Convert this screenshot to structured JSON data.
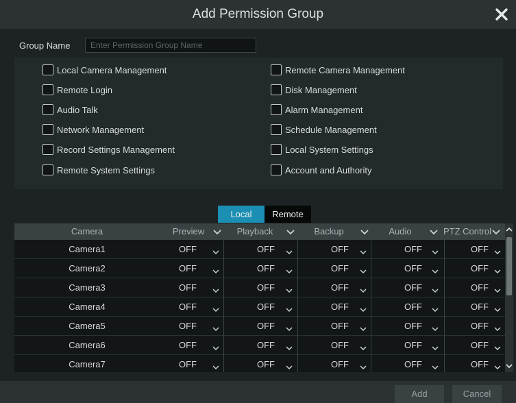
{
  "dialog": {
    "title": "Add Permission Group",
    "close_icon": "close-icon"
  },
  "group": {
    "label": "Group Name",
    "value": "",
    "placeholder": "Enter Permission Group Name"
  },
  "permissions": {
    "left": [
      {
        "label": "Local Camera Management",
        "checked": false
      },
      {
        "label": "Remote Login",
        "checked": false
      },
      {
        "label": "Audio Talk",
        "checked": false
      },
      {
        "label": "Network Management",
        "checked": false
      },
      {
        "label": "Record Settings Management",
        "checked": false
      },
      {
        "label": "Remote System Settings",
        "checked": false
      }
    ],
    "right": [
      {
        "label": "Remote Camera Management",
        "checked": false
      },
      {
        "label": "Disk Management",
        "checked": false
      },
      {
        "label": "Alarm Management",
        "checked": false
      },
      {
        "label": "Schedule Management",
        "checked": false
      },
      {
        "label": "Local System Settings",
        "checked": false
      },
      {
        "label": "Account and Authority",
        "checked": false
      }
    ]
  },
  "tabs": [
    {
      "label": "Local",
      "active": true
    },
    {
      "label": "Remote",
      "active": false
    }
  ],
  "table": {
    "headers": [
      "Camera",
      "Preview",
      "Playback",
      "Backup",
      "Audio",
      "PTZ Control"
    ],
    "rows": [
      {
        "camera": "Camera1",
        "values": [
          "OFF",
          "OFF",
          "OFF",
          "OFF",
          "OFF"
        ]
      },
      {
        "camera": "Camera2",
        "values": [
          "OFF",
          "OFF",
          "OFF",
          "OFF",
          "OFF"
        ]
      },
      {
        "camera": "Camera3",
        "values": [
          "OFF",
          "OFF",
          "OFF",
          "OFF",
          "OFF"
        ]
      },
      {
        "camera": "Camera4",
        "values": [
          "OFF",
          "OFF",
          "OFF",
          "OFF",
          "OFF"
        ]
      },
      {
        "camera": "Camera5",
        "values": [
          "OFF",
          "OFF",
          "OFF",
          "OFF",
          "OFF"
        ]
      },
      {
        "camera": "Camera6",
        "values": [
          "OFF",
          "OFF",
          "OFF",
          "OFF",
          "OFF"
        ]
      },
      {
        "camera": "Camera7",
        "values": [
          "OFF",
          "OFF",
          "OFF",
          "OFF",
          "OFF"
        ]
      }
    ]
  },
  "buttons": {
    "add": "Add",
    "cancel": "Cancel"
  },
  "colors": {
    "accent": "#1b8fb3",
    "background": "#1d2324",
    "header": "#2c3234"
  }
}
